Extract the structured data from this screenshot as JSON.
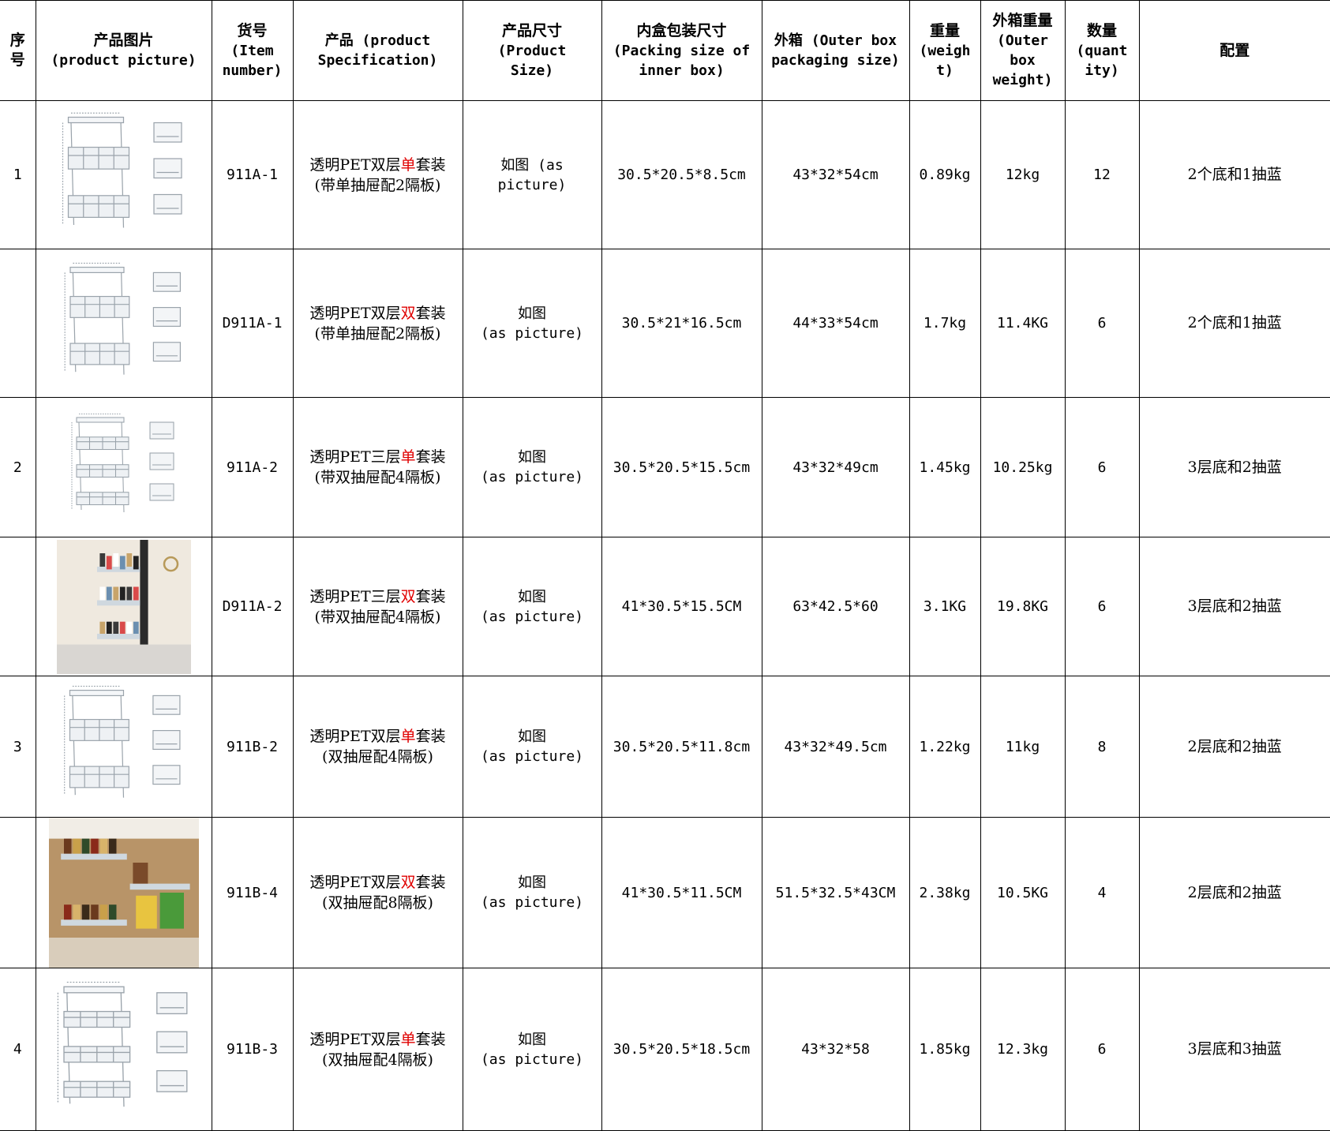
{
  "headers": {
    "seq": "序号",
    "picture": [
      "产品图片",
      "(product picture)"
    ],
    "item": [
      "货号",
      "(Item",
      "number)"
    ],
    "product": [
      "产品 (product",
      "Specification)"
    ],
    "size": [
      "产品尺寸",
      "(Product",
      "Size)"
    ],
    "inner": [
      "内盒包装尺寸",
      "(Packing size of",
      "inner box)"
    ],
    "outer": [
      "外箱 (Outer box",
      "packaging size)"
    ],
    "weight": [
      "重量",
      "(weigh",
      "t)"
    ],
    "outer_weight": [
      "外箱重量",
      "(Outer",
      "box",
      "weight)"
    ],
    "qty": [
      "数量",
      "(quant",
      "ity)"
    ],
    "config": "配置"
  },
  "rows": [
    {
      "seq": "1",
      "item": "911A-1",
      "prod_a": "透明PET双层",
      "prod_hl": "单",
      "prod_b": "套装",
      "prod_line2": "(带单抽屉配2隔板)",
      "size_l1": "如图 (as",
      "size_l2": "picture)",
      "inner": "30.5*20.5*8.5cm",
      "outer": "43*32*54cm",
      "weight": "0.89kg",
      "outer_weight": "12kg",
      "qty": "12",
      "config": "2个底和1抽蓝",
      "icon": "two-tier-organizer-diagram-icon"
    },
    {
      "seq": "",
      "item": "D911A-1",
      "prod_a": "透明PET双层",
      "prod_hl": "双",
      "prod_b": "套装",
      "prod_line2": "(带单抽屉配2隔板)",
      "size_l1": "如图",
      "size_l2": "(as picture)",
      "inner": "30.5*21*16.5cm",
      "outer": "44*33*54cm",
      "weight": "1.7kg",
      "outer_weight": "11.4KG",
      "qty": "6",
      "config": "2个底和1抽蓝",
      "icon": "two-tier-organizer-diagram-icon"
    },
    {
      "seq": "2",
      "item": "911A-2",
      "prod_a": "透明PET三层",
      "prod_hl": "单",
      "prod_b": "套装",
      "prod_line2": "(带双抽屉配4隔板)",
      "size_l1": "如图",
      "size_l2": "(as picture)",
      "inner": "30.5*20.5*15.5cm",
      "outer": "43*32*49cm",
      "weight": "1.45kg",
      "outer_weight": "10.25kg",
      "qty": "6",
      "config": "3层底和2抽蓝",
      "icon": "three-tier-organizer-diagram-icon"
    },
    {
      "seq": "",
      "item": "D911A-2",
      "prod_a": "透明PET三层",
      "prod_hl": "双",
      "prod_b": "套装",
      "prod_line2": "(带双抽屉配4隔板)",
      "size_l1": "如图",
      "size_l2": "(as picture)",
      "inner": "41*30.5*15.5CM",
      "outer": "63*42.5*60",
      "weight": "3.1KG",
      "outer_weight": "19.8KG",
      "qty": "6",
      "config": "3层底和2抽蓝",
      "icon": "bathroom-organizer-photo-icon"
    },
    {
      "seq": "3",
      "item": "911B-2",
      "prod_a": "透明PET双层",
      "prod_hl": "单",
      "prod_b": "套装",
      "prod_line2": "(双抽屉配4隔板)",
      "size_l1": "如图",
      "size_l2": "(as picture)",
      "inner": "30.5*20.5*11.8cm",
      "outer": "43*32*49.5cm",
      "weight": "1.22kg",
      "outer_weight": "11kg",
      "qty": "8",
      "config": "2层底和2抽蓝",
      "icon": "two-drawer-organizer-diagram-icon"
    },
    {
      "seq": "",
      "item": "911B-4",
      "prod_a": "透明PET双层",
      "prod_hl": "双",
      "prod_b": "套装",
      "prod_line2": "(双抽屉配8隔板)",
      "size_l1": "如图",
      "size_l2": "(as picture)",
      "inner": "41*30.5*11.5CM",
      "outer": "51.5*32.5*43CM",
      "weight": "2.38kg",
      "outer_weight": "10.5KG",
      "qty": "4",
      "config": "2层底和2抽蓝",
      "icon": "kitchen-cabinet-organizer-photo-icon"
    },
    {
      "seq": "4",
      "item": "911B-3",
      "prod_a": "透明PET双层",
      "prod_hl": "单",
      "prod_b": "套装",
      "prod_line2": "(双抽屉配4隔板)",
      "size_l1": "如图",
      "size_l2": "(as picture)",
      "inner": "30.5*20.5*18.5cm",
      "outer": "43*32*58",
      "weight": "1.85kg",
      "outer_weight": "12.3kg",
      "qty": "6",
      "config": "3层底和3抽蓝",
      "icon": "three-tier-organizer-diagram-icon"
    }
  ]
}
